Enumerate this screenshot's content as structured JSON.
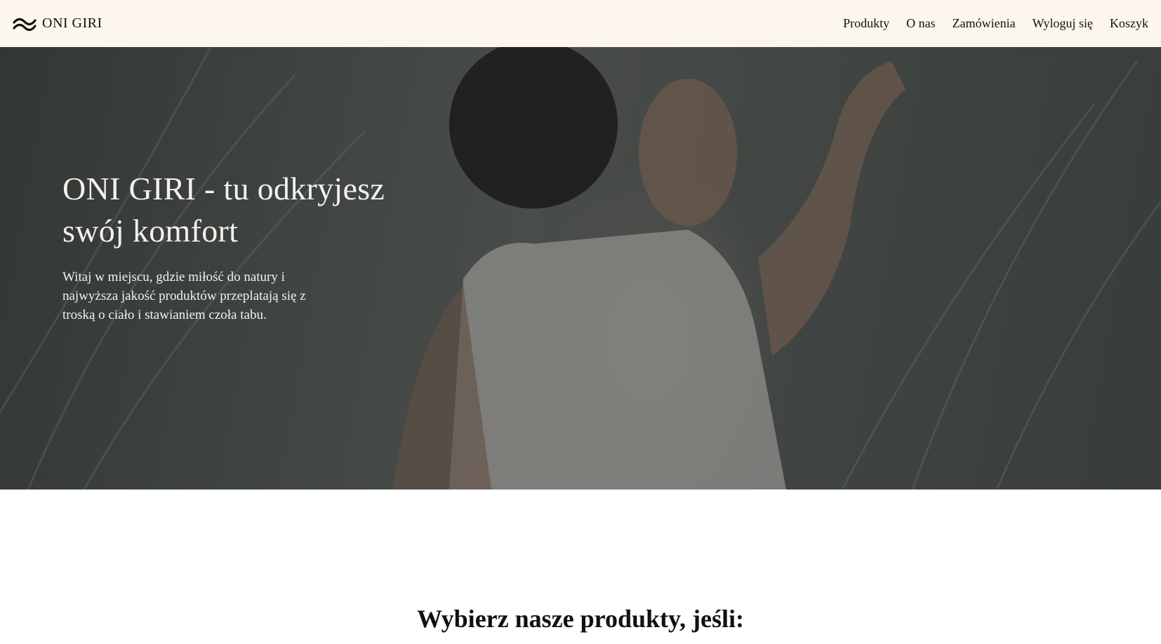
{
  "header": {
    "brand": "ONI GIRI",
    "logo_icon": "wave-icon"
  },
  "nav": {
    "items": [
      {
        "label": "Produkty"
      },
      {
        "label": "O nas"
      },
      {
        "label": "Zamówienia"
      },
      {
        "label": "Wyloguj się"
      },
      {
        "label": "Koszyk"
      }
    ]
  },
  "hero": {
    "title_line1": "ONI GIRI - tu odkryjesz",
    "title_line2": "swój komfort",
    "subtitle": "Witaj w miejscu, gdzie miłość do natury i najwyższa jakość produktów przeplatają się z troską o ciało i stawianiem czoła tabu."
  },
  "section": {
    "title": "Wybierz nasze produkty, jeśli:"
  },
  "colors": {
    "header_bg": "#fdf6ec",
    "text_dark": "#111111",
    "hero_text": "#f4f1ec"
  }
}
